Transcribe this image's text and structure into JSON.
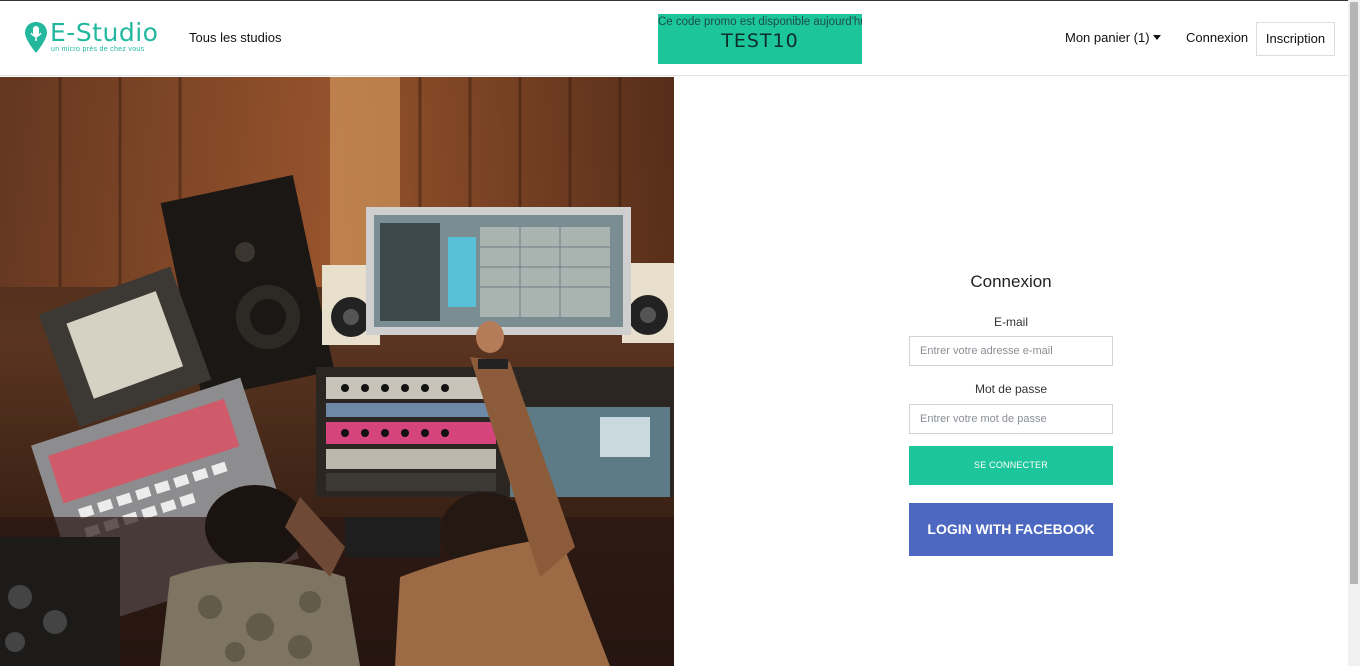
{
  "header": {
    "logo": {
      "name": "E-Studio",
      "tagline": "un micro près de chez vous",
      "icon": "microphone-pin-icon"
    },
    "nav_studios": "Tous les studios",
    "promo": {
      "message": "Ce code promo est disponible aujourd'hui",
      "code": "TEST10"
    },
    "cart_label": "Mon panier (1)",
    "login_label": "Connexion",
    "signup_label": "Inscription"
  },
  "login": {
    "title": "Connexion",
    "email_label": "E-mail",
    "email_placeholder": "Entrer votre adresse e-mail",
    "email_value": "",
    "password_label": "Mot de passe",
    "password_placeholder": "Entrer votre mot de passe",
    "password_value": "",
    "submit_label": "SE CONNECTER",
    "facebook_label": "LOGIN WITH FACEBOOK"
  },
  "colors": {
    "accent": "#1dc59a",
    "brand": "#23b89e",
    "facebook": "#4d68c0"
  }
}
